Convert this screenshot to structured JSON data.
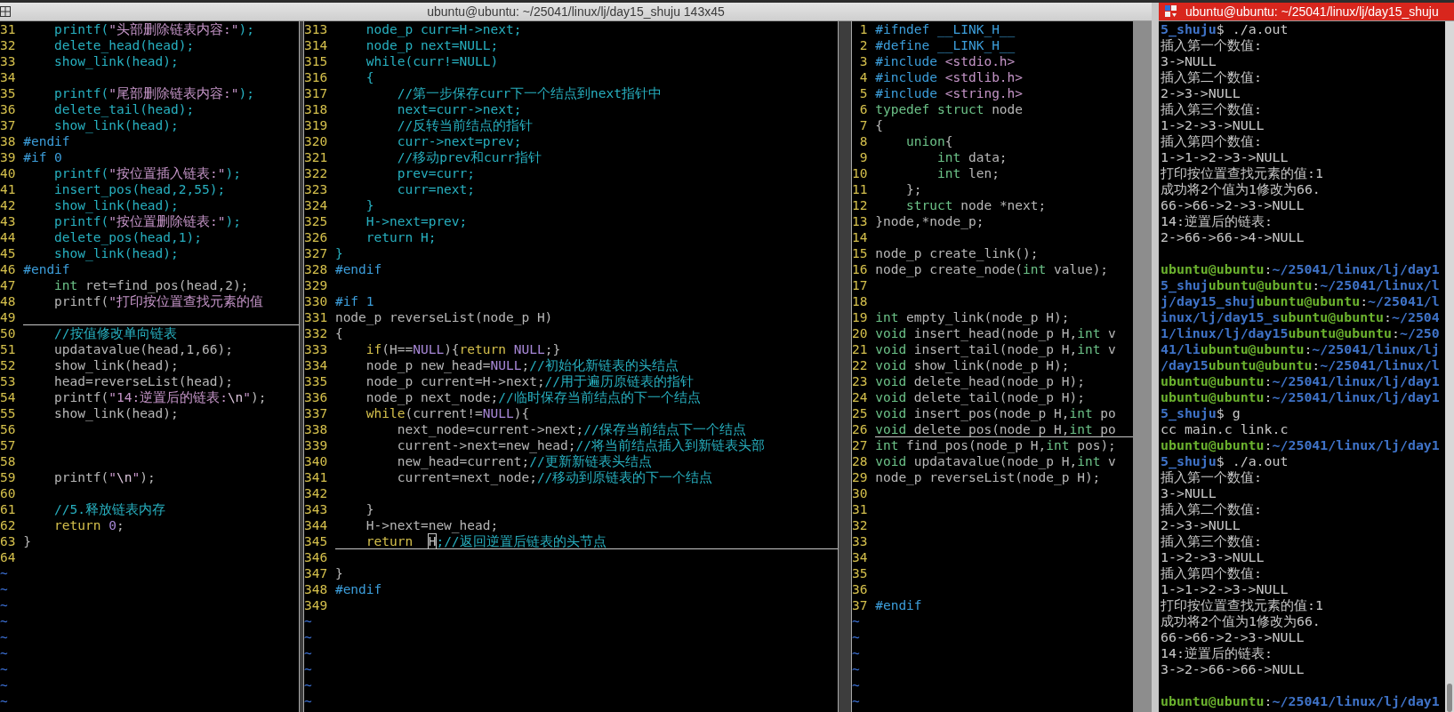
{
  "editor_window": {
    "title": "ubuntu@ubuntu: ~/25041/linux/lj/day15_shuju 143x45",
    "panes": [
      {
        "lines": [
          {
            "number": "31",
            "current": false,
            "tokens": [
              {
                "kind": "comment",
                "text": "    printf("
              },
              {
                "kind": "string",
                "text": "\"头部删除链表内容:\""
              },
              {
                "kind": "comment",
                "text": ");"
              }
            ]
          },
          {
            "number": "32",
            "current": false,
            "tokens": [
              {
                "kind": "comment",
                "text": "    delete_head(head);"
              }
            ]
          },
          {
            "number": "33",
            "current": false,
            "tokens": [
              {
                "kind": "comment",
                "text": "    show_link(head);"
              }
            ]
          },
          {
            "number": "34",
            "current": false
          },
          {
            "number": "35",
            "current": false,
            "tokens": [
              {
                "kind": "comment",
                "text": "    printf("
              },
              {
                "kind": "string",
                "text": "\"尾部删除链表内容:\""
              },
              {
                "kind": "comment",
                "text": ");"
              }
            ]
          },
          {
            "number": "36",
            "current": false,
            "tokens": [
              {
                "kind": "comment",
                "text": "    delete_tail(head);"
              }
            ]
          },
          {
            "number": "37",
            "current": false,
            "tokens": [
              {
                "kind": "comment",
                "text": "    show_link(head);"
              }
            ]
          },
          {
            "number": "38",
            "current": false,
            "tokens": [
              {
                "kind": "preproc",
                "text": "#endif"
              }
            ]
          },
          {
            "number": "39",
            "current": false,
            "tokens": [
              {
                "kind": "preproc",
                "text": "#if 0"
              }
            ]
          },
          {
            "number": "40",
            "current": false,
            "tokens": [
              {
                "kind": "comment",
                "text": "    printf("
              },
              {
                "kind": "string",
                "text": "\"按位置插入链表:\""
              },
              {
                "kind": "comment",
                "text": ");"
              }
            ]
          },
          {
            "number": "41",
            "current": false,
            "tokens": [
              {
                "kind": "comment",
                "text": "    insert_pos(head,2,55);"
              }
            ]
          },
          {
            "number": "42",
            "current": false,
            "tokens": [
              {
                "kind": "comment",
                "text": "    show_link(head);"
              }
            ]
          },
          {
            "number": "43",
            "current": false,
            "tokens": [
              {
                "kind": "comment",
                "text": "    printf("
              },
              {
                "kind": "string",
                "text": "\"按位置删除链表:\""
              },
              {
                "kind": "comment",
                "text": ");"
              }
            ]
          },
          {
            "number": "44",
            "current": false,
            "tokens": [
              {
                "kind": "comment",
                "text": "    delete_pos(head,1);"
              }
            ]
          },
          {
            "number": "45",
            "current": false,
            "tokens": [
              {
                "kind": "comment",
                "text": "    show_link(head);"
              }
            ]
          },
          {
            "number": "46",
            "current": false,
            "tokens": [
              {
                "kind": "preproc",
                "text": "#endif"
              }
            ]
          },
          {
            "number": "47",
            "current": false,
            "tokens": [
              {
                "kind": "type",
                "text": "    int"
              },
              {
                "kind": "plain",
                "text": " ret=find_pos(head,2);"
              }
            ]
          },
          {
            "number": "48",
            "current": false,
            "tokens": [
              {
                "kind": "plain",
                "text": "    printf("
              },
              {
                "kind": "string",
                "text": "\"打印按位置查找元素的值"
              }
            ]
          },
          {
            "number": "49",
            "current": true
          },
          {
            "number": "50",
            "current": false,
            "tokens": [
              {
                "kind": "comment",
                "text": "    //按值修改单向链表"
              }
            ]
          },
          {
            "number": "51",
            "current": false,
            "tokens": [
              {
                "kind": "plain",
                "text": "    updatavalue(head,1,66);"
              }
            ]
          },
          {
            "number": "52",
            "current": false,
            "tokens": [
              {
                "kind": "plain",
                "text": "    show_link(head);"
              }
            ]
          },
          {
            "number": "53",
            "current": false,
            "tokens": [
              {
                "kind": "plain",
                "text": "    head=reverseList(head);"
              }
            ]
          },
          {
            "number": "54",
            "current": false,
            "tokens": [
              {
                "kind": "plain",
                "text": "    printf("
              },
              {
                "kind": "string",
                "text": "\"14:逆置后的链表:"
              },
              {
                "kind": "special",
                "text": "\\n"
              },
              {
                "kind": "string",
                "text": "\""
              },
              {
                "kind": "plain",
                "text": ");"
              }
            ]
          },
          {
            "number": "55",
            "current": false,
            "tokens": [
              {
                "kind": "plain",
                "text": "    show_link(head);"
              }
            ]
          },
          {
            "number": "56",
            "current": false
          },
          {
            "number": "57",
            "current": false
          },
          {
            "number": "58",
            "current": false
          },
          {
            "number": "59",
            "current": false,
            "tokens": [
              {
                "kind": "plain",
                "text": "    printf("
              },
              {
                "kind": "string",
                "text": "\""
              },
              {
                "kind": "special",
                "text": "\\n"
              },
              {
                "kind": "string",
                "text": "\""
              },
              {
                "kind": "plain",
                "text": ");"
              }
            ]
          },
          {
            "number": "60",
            "current": false
          },
          {
            "number": "61",
            "current": false,
            "tokens": [
              {
                "kind": "comment",
                "text": "    //5.释放链表内存"
              }
            ]
          },
          {
            "number": "62",
            "current": false,
            "tokens": [
              {
                "kind": "keyword",
                "text": "    return"
              },
              {
                "kind": "constant",
                "text": " 0"
              },
              {
                "kind": "plain",
                "text": ";"
              }
            ]
          },
          {
            "number": "63",
            "current": false,
            "tokens": [
              {
                "kind": "plain",
                "text": "}"
              }
            ]
          },
          {
            "number": "64",
            "current": false
          }
        ],
        "filler": [
          "~",
          "~",
          "~",
          "~",
          "~",
          "~",
          "~",
          "~",
          "~"
        ]
      },
      {
        "lines": [
          {
            "number": "313",
            "current": false,
            "tokens": [
              {
                "kind": "comment",
                "text": "    node_p curr=H->next;"
              }
            ]
          },
          {
            "number": "314",
            "current": false,
            "tokens": [
              {
                "kind": "comment",
                "text": "    node_p next=NULL;"
              }
            ]
          },
          {
            "number": "315",
            "current": false,
            "tokens": [
              {
                "kind": "comment",
                "text": "    while(curr!=NULL)"
              }
            ]
          },
          {
            "number": "316",
            "current": false,
            "tokens": [
              {
                "kind": "comment",
                "text": "    {"
              }
            ]
          },
          {
            "number": "317",
            "current": false,
            "tokens": [
              {
                "kind": "comment",
                "text": "        //第一步保存curr下一个结点到next指针中"
              }
            ]
          },
          {
            "number": "318",
            "current": false,
            "tokens": [
              {
                "kind": "comment",
                "text": "        next=curr->next;"
              }
            ]
          },
          {
            "number": "319",
            "current": false,
            "tokens": [
              {
                "kind": "comment",
                "text": "        //反转当前结点的指针"
              }
            ]
          },
          {
            "number": "320",
            "current": false,
            "tokens": [
              {
                "kind": "comment",
                "text": "        curr->next=prev;"
              }
            ]
          },
          {
            "number": "321",
            "current": false,
            "tokens": [
              {
                "kind": "comment",
                "text": "        //移动prev和curr指针"
              }
            ]
          },
          {
            "number": "322",
            "current": false,
            "tokens": [
              {
                "kind": "comment",
                "text": "        prev=curr;"
              }
            ]
          },
          {
            "number": "323",
            "current": false,
            "tokens": [
              {
                "kind": "comment",
                "text": "        curr=next;"
              }
            ]
          },
          {
            "number": "324",
            "current": false,
            "tokens": [
              {
                "kind": "comment",
                "text": "    }"
              }
            ]
          },
          {
            "number": "325",
            "current": false,
            "tokens": [
              {
                "kind": "comment",
                "text": "    H->next=prev;"
              }
            ]
          },
          {
            "number": "326",
            "current": false,
            "tokens": [
              {
                "kind": "comment",
                "text": "    return H;"
              }
            ]
          },
          {
            "number": "327",
            "current": false,
            "tokens": [
              {
                "kind": "comment",
                "text": "}"
              }
            ]
          },
          {
            "number": "328",
            "current": false,
            "tokens": [
              {
                "kind": "preproc",
                "text": "#endif"
              }
            ]
          },
          {
            "number": "329",
            "current": false
          },
          {
            "number": "330",
            "current": false,
            "tokens": [
              {
                "kind": "preproc",
                "text": "#if 1"
              }
            ]
          },
          {
            "number": "331",
            "current": false,
            "tokens": [
              {
                "kind": "plain",
                "text": "node_p reverseList(node_p H)"
              }
            ]
          },
          {
            "number": "332",
            "current": false,
            "tokens": [
              {
                "kind": "plain",
                "text": "{"
              }
            ]
          },
          {
            "number": "333",
            "current": false,
            "tokens": [
              {
                "kind": "keyword",
                "text": "    if"
              },
              {
                "kind": "plain",
                "text": "(H=="
              },
              {
                "kind": "constant",
                "text": "NULL"
              },
              {
                "kind": "plain",
                "text": "){"
              },
              {
                "kind": "keyword",
                "text": "return"
              },
              {
                "kind": "constant",
                "text": " NULL"
              },
              {
                "kind": "plain",
                "text": ";}"
              }
            ]
          },
          {
            "number": "334",
            "current": false,
            "tokens": [
              {
                "kind": "plain",
                "text": "    node_p new_head="
              },
              {
                "kind": "constant",
                "text": "NULL"
              },
              {
                "kind": "plain",
                "text": ";"
              },
              {
                "kind": "comment",
                "text": "//初始化新链表的头结点"
              }
            ]
          },
          {
            "number": "335",
            "current": false,
            "tokens": [
              {
                "kind": "plain",
                "text": "    node_p current=H->next;"
              },
              {
                "kind": "comment",
                "text": "//用于遍历原链表的指针"
              }
            ]
          },
          {
            "number": "336",
            "current": false,
            "tokens": [
              {
                "kind": "plain",
                "text": "    node_p next_node;"
              },
              {
                "kind": "comment",
                "text": "//临时保存当前结点的下一个结点"
              }
            ]
          },
          {
            "number": "337",
            "current": false,
            "tokens": [
              {
                "kind": "keyword",
                "text": "    while"
              },
              {
                "kind": "plain",
                "text": "(current!="
              },
              {
                "kind": "constant",
                "text": "NULL"
              },
              {
                "kind": "plain",
                "text": "){"
              }
            ]
          },
          {
            "number": "338",
            "current": false,
            "tokens": [
              {
                "kind": "plain",
                "text": "        next_node=current->next;"
              },
              {
                "kind": "comment",
                "text": "//保存当前结点下一个结点"
              }
            ]
          },
          {
            "number": "339",
            "current": false,
            "tokens": [
              {
                "kind": "plain",
                "text": "        current->next=new_head;"
              },
              {
                "kind": "comment",
                "text": "//将当前结点插入到新链表头部"
              }
            ]
          },
          {
            "number": "340",
            "current": false,
            "tokens": [
              {
                "kind": "plain",
                "text": "        new_head=current;"
              },
              {
                "kind": "comment",
                "text": "//更新新链表头结点"
              }
            ]
          },
          {
            "number": "341",
            "current": false,
            "tokens": [
              {
                "kind": "plain",
                "text": "        current=next_node;"
              },
              {
                "kind": "comment",
                "text": "//移动到原链表的下一个结点"
              }
            ]
          },
          {
            "number": "342",
            "current": false
          },
          {
            "number": "343",
            "current": false,
            "tokens": [
              {
                "kind": "plain",
                "text": "    }"
              }
            ]
          },
          {
            "number": "344",
            "current": false,
            "tokens": [
              {
                "kind": "plain",
                "text": "    H->next=new_head;"
              }
            ]
          },
          {
            "number": "345",
            "current": true,
            "tokens": [
              {
                "kind": "keyword",
                "text": "    return  "
              },
              {
                "kind": "cursor",
                "text": "H"
              },
              {
                "kind": "comment",
                "text": ";//返回逆置后链表的头节点"
              }
            ]
          },
          {
            "number": "346",
            "current": false
          },
          {
            "number": "347",
            "current": false,
            "tokens": [
              {
                "kind": "plain",
                "text": "}"
              }
            ]
          },
          {
            "number": "348",
            "current": false,
            "tokens": [
              {
                "kind": "preproc",
                "text": "#endif"
              }
            ]
          },
          {
            "number": "349",
            "current": false
          }
        ],
        "filler": [
          "~",
          "~",
          "~",
          "~",
          "~",
          "~"
        ]
      },
      {
        "lines": [
          {
            "number": "1",
            "current": false,
            "tokens": [
              {
                "kind": "preproc",
                "text": "#ifndef __LINK_H__"
              }
            ]
          },
          {
            "number": "2",
            "current": false,
            "tokens": [
              {
                "kind": "preproc",
                "text": "#define __LINK_H__"
              }
            ]
          },
          {
            "number": "3",
            "current": false,
            "tokens": [
              {
                "kind": "preproc",
                "text": "#include "
              },
              {
                "kind": "string",
                "text": "<stdio.h>"
              }
            ]
          },
          {
            "number": "4",
            "current": false,
            "tokens": [
              {
                "kind": "preproc",
                "text": "#include "
              },
              {
                "kind": "string",
                "text": "<stdlib.h>"
              }
            ]
          },
          {
            "number": "5",
            "current": false,
            "tokens": [
              {
                "kind": "preproc",
                "text": "#include "
              },
              {
                "kind": "string",
                "text": "<string.h>"
              }
            ]
          },
          {
            "number": "6",
            "current": false,
            "tokens": [
              {
                "kind": "type",
                "text": "typedef struct"
              },
              {
                "kind": "plain",
                "text": " node"
              }
            ]
          },
          {
            "number": "7",
            "current": false,
            "tokens": [
              {
                "kind": "plain",
                "text": "{"
              }
            ]
          },
          {
            "number": "8",
            "current": false,
            "tokens": [
              {
                "kind": "type",
                "text": "    union"
              },
              {
                "kind": "plain",
                "text": "{"
              }
            ]
          },
          {
            "number": "9",
            "current": false,
            "tokens": [
              {
                "kind": "type",
                "text": "        int"
              },
              {
                "kind": "plain",
                "text": " data;"
              }
            ]
          },
          {
            "number": "10",
            "current": false,
            "tokens": [
              {
                "kind": "type",
                "text": "        int"
              },
              {
                "kind": "plain",
                "text": " len;"
              }
            ]
          },
          {
            "number": "11",
            "current": false,
            "tokens": [
              {
                "kind": "plain",
                "text": "    };"
              }
            ]
          },
          {
            "number": "12",
            "current": false,
            "tokens": [
              {
                "kind": "type",
                "text": "    struct"
              },
              {
                "kind": "plain",
                "text": " node *next;"
              }
            ]
          },
          {
            "number": "13",
            "current": false,
            "tokens": [
              {
                "kind": "plain",
                "text": "}node,*node_p;"
              }
            ]
          },
          {
            "number": "14",
            "current": false
          },
          {
            "number": "15",
            "current": false,
            "tokens": [
              {
                "kind": "plain",
                "text": "node_p create_link();"
              }
            ]
          },
          {
            "number": "16",
            "current": false,
            "tokens": [
              {
                "kind": "plain",
                "text": "node_p create_node("
              },
              {
                "kind": "type",
                "text": "int"
              },
              {
                "kind": "plain",
                "text": " value);"
              }
            ]
          },
          {
            "number": "17",
            "current": false
          },
          {
            "number": "18",
            "current": false
          },
          {
            "number": "19",
            "current": false,
            "tokens": [
              {
                "kind": "type",
                "text": "int"
              },
              {
                "kind": "plain",
                "text": " empty_link(node_p H);"
              }
            ]
          },
          {
            "number": "20",
            "current": false,
            "tokens": [
              {
                "kind": "type",
                "text": "void"
              },
              {
                "kind": "plain",
                "text": " insert_head(node_p H,"
              },
              {
                "kind": "type",
                "text": "int"
              },
              {
                "kind": "plain",
                "text": " v"
              }
            ]
          },
          {
            "number": "21",
            "current": false,
            "tokens": [
              {
                "kind": "type",
                "text": "void"
              },
              {
                "kind": "plain",
                "text": " insert_tail(node_p H,"
              },
              {
                "kind": "type",
                "text": "int"
              },
              {
                "kind": "plain",
                "text": " v"
              }
            ]
          },
          {
            "number": "22",
            "current": false,
            "tokens": [
              {
                "kind": "type",
                "text": "void"
              },
              {
                "kind": "plain",
                "text": " show_link(node_p H);"
              }
            ]
          },
          {
            "number": "23",
            "current": false,
            "tokens": [
              {
                "kind": "type",
                "text": "void"
              },
              {
                "kind": "plain",
                "text": " delete_head(node_p H);"
              }
            ]
          },
          {
            "number": "24",
            "current": false,
            "tokens": [
              {
                "kind": "type",
                "text": "void"
              },
              {
                "kind": "plain",
                "text": " delete_tail(node_p H);"
              }
            ]
          },
          {
            "number": "25",
            "current": false,
            "tokens": [
              {
                "kind": "type",
                "text": "void"
              },
              {
                "kind": "plain",
                "text": " insert_pos(node_p H,"
              },
              {
                "kind": "type",
                "text": "int"
              },
              {
                "kind": "plain",
                "text": " po"
              }
            ]
          },
          {
            "number": "26",
            "current": true,
            "tokens": [
              {
                "kind": "type",
                "text": "void"
              },
              {
                "kind": "plain",
                "text": " delete_pos(node_p H,"
              },
              {
                "kind": "type",
                "text": "int"
              },
              {
                "kind": "plain",
                "text": " po"
              }
            ]
          },
          {
            "number": "27",
            "current": false,
            "tokens": [
              {
                "kind": "type",
                "text": "int"
              },
              {
                "kind": "plain",
                "text": " find_pos(node_p H,"
              },
              {
                "kind": "type",
                "text": "int"
              },
              {
                "kind": "plain",
                "text": " pos);"
              }
            ]
          },
          {
            "number": "28",
            "current": false,
            "tokens": [
              {
                "kind": "type",
                "text": "void"
              },
              {
                "kind": "plain",
                "text": " updatavalue(node_p H,"
              },
              {
                "kind": "type",
                "text": "int"
              },
              {
                "kind": "plain",
                "text": " v"
              }
            ]
          },
          {
            "number": "29",
            "current": false,
            "tokens": [
              {
                "kind": "plain",
                "text": "node_p reverseList(node_p H);"
              }
            ]
          },
          {
            "number": "30",
            "current": false
          },
          {
            "number": "31",
            "current": false
          },
          {
            "number": "32",
            "current": false
          },
          {
            "number": "33",
            "current": false
          },
          {
            "number": "34",
            "current": false
          },
          {
            "number": "35",
            "current": false
          },
          {
            "number": "36",
            "current": false
          },
          {
            "number": "37",
            "current": false,
            "tokens": [
              {
                "kind": "preproc",
                "text": "#endif"
              }
            ]
          }
        ],
        "filler": [
          "~",
          "~",
          "~",
          "~",
          "~",
          "~"
        ]
      }
    ]
  },
  "terminal_window": {
    "title": "ubuntu@ubuntu: ~/25041/linux/lj/day15_shuju",
    "lines": [
      {
        "kind": "text",
        "segments": [
          {
            "kind": "path",
            "text": "5_shuju"
          },
          {
            "kind": "plain",
            "text": "$ ./a.out"
          }
        ]
      },
      {
        "kind": "text",
        "segments": [
          {
            "kind": "plain",
            "text": "插入第一个数值:"
          }
        ]
      },
      {
        "kind": "text",
        "segments": [
          {
            "kind": "plain",
            "text": "3->NULL"
          }
        ]
      },
      {
        "kind": "text",
        "segments": [
          {
            "kind": "plain",
            "text": "插入第二个数值:"
          }
        ]
      },
      {
        "kind": "text",
        "segments": [
          {
            "kind": "plain",
            "text": "2->3->NULL"
          }
        ]
      },
      {
        "kind": "text",
        "segments": [
          {
            "kind": "plain",
            "text": "插入第三个数值:"
          }
        ]
      },
      {
        "kind": "text",
        "segments": [
          {
            "kind": "plain",
            "text": "1->2->3->NULL"
          }
        ]
      },
      {
        "kind": "text",
        "segments": [
          {
            "kind": "plain",
            "text": "插入第四个数值:"
          }
        ]
      },
      {
        "kind": "text",
        "segments": [
          {
            "kind": "plain",
            "text": "1->1->2->3->NULL"
          }
        ]
      },
      {
        "kind": "text",
        "segments": [
          {
            "kind": "plain",
            "text": "打印按位置查找元素的值:1"
          }
        ]
      },
      {
        "kind": "text",
        "segments": [
          {
            "kind": "plain",
            "text": "成功将2个值为1修改为66."
          }
        ]
      },
      {
        "kind": "text",
        "segments": [
          {
            "kind": "plain",
            "text": "66->66->2->3->NULL"
          }
        ]
      },
      {
        "kind": "text",
        "segments": [
          {
            "kind": "plain",
            "text": "14:逆置后的链表:"
          }
        ]
      },
      {
        "kind": "text",
        "segments": [
          {
            "kind": "plain",
            "text": "2->66->66->4->NULL"
          }
        ]
      },
      {
        "kind": "blank"
      },
      {
        "kind": "text",
        "segments": [
          {
            "kind": "user",
            "text": "ubuntu@ubuntu"
          },
          {
            "kind": "plain",
            "text": ":"
          },
          {
            "kind": "path",
            "text": "~/25041/linux/lj/day1"
          }
        ]
      },
      {
        "kind": "text",
        "segments": [
          {
            "kind": "path",
            "text": "5_shuj"
          },
          {
            "kind": "user",
            "text": "ubuntu@ubuntu"
          },
          {
            "kind": "plain",
            "text": ":"
          },
          {
            "kind": "path",
            "text": "~/25041/linux/l"
          }
        ]
      },
      {
        "kind": "text",
        "segments": [
          {
            "kind": "path",
            "text": "j/day15_shuj"
          },
          {
            "kind": "user",
            "text": "ubuntu@ubuntu"
          },
          {
            "kind": "plain",
            "text": ":"
          },
          {
            "kind": "path",
            "text": "~/25041/l"
          }
        ]
      },
      {
        "kind": "text",
        "segments": [
          {
            "kind": "path",
            "text": "inux/lj/day15_s"
          },
          {
            "kind": "user",
            "text": "ubuntu@ubuntu"
          },
          {
            "kind": "plain",
            "text": ":"
          },
          {
            "kind": "path",
            "text": "~/2504"
          }
        ]
      },
      {
        "kind": "text",
        "segments": [
          {
            "kind": "path",
            "text": "1/linux/lj/day15"
          },
          {
            "kind": "user",
            "text": "ubuntu@ubuntu"
          },
          {
            "kind": "plain",
            "text": ":"
          },
          {
            "kind": "path",
            "text": "~/250"
          }
        ]
      },
      {
        "kind": "text",
        "segments": [
          {
            "kind": "path",
            "text": "41/li"
          },
          {
            "kind": "user",
            "text": "ubuntu@ubuntu"
          },
          {
            "kind": "plain",
            "text": ":"
          },
          {
            "kind": "path",
            "text": "~/25041/linux/lj"
          }
        ]
      },
      {
        "kind": "text",
        "segments": [
          {
            "kind": "path",
            "text": "/day15"
          },
          {
            "kind": "user",
            "text": "ubuntu@ubuntu"
          },
          {
            "kind": "plain",
            "text": ":"
          },
          {
            "kind": "path",
            "text": "~/25041/linux/l"
          }
        ]
      },
      {
        "kind": "text",
        "segments": [
          {
            "kind": "user",
            "text": "ubuntu@ubuntu"
          },
          {
            "kind": "plain",
            "text": ":"
          },
          {
            "kind": "path",
            "text": "~/25041/linux/lj/day1"
          }
        ]
      },
      {
        "kind": "text",
        "segments": [
          {
            "kind": "user",
            "text": "ubuntu@ubuntu"
          },
          {
            "kind": "plain",
            "text": ":"
          },
          {
            "kind": "path",
            "text": "~/25041/linux/lj/day1"
          }
        ]
      },
      {
        "kind": "text",
        "segments": [
          {
            "kind": "path",
            "text": "5_shuju"
          },
          {
            "kind": "plain",
            "text": "$ g"
          }
        ]
      },
      {
        "kind": "text",
        "segments": [
          {
            "kind": "plain",
            "text": "cc main.c link.c"
          }
        ]
      },
      {
        "kind": "text",
        "segments": [
          {
            "kind": "user",
            "text": "ubuntu@ubuntu"
          },
          {
            "kind": "plain",
            "text": ":"
          },
          {
            "kind": "path",
            "text": "~/25041/linux/lj/day1"
          }
        ]
      },
      {
        "kind": "text",
        "segments": [
          {
            "kind": "path",
            "text": "5_shuju"
          },
          {
            "kind": "plain",
            "text": "$ ./a.out"
          }
        ]
      },
      {
        "kind": "text",
        "segments": [
          {
            "kind": "plain",
            "text": "插入第一个数值:"
          }
        ]
      },
      {
        "kind": "text",
        "segments": [
          {
            "kind": "plain",
            "text": "3->NULL"
          }
        ]
      },
      {
        "kind": "text",
        "segments": [
          {
            "kind": "plain",
            "text": "插入第二个数值:"
          }
        ]
      },
      {
        "kind": "text",
        "segments": [
          {
            "kind": "plain",
            "text": "2->3->NULL"
          }
        ]
      },
      {
        "kind": "text",
        "segments": [
          {
            "kind": "plain",
            "text": "插入第三个数值:"
          }
        ]
      },
      {
        "kind": "text",
        "segments": [
          {
            "kind": "plain",
            "text": "1->2->3->NULL"
          }
        ]
      },
      {
        "kind": "text",
        "segments": [
          {
            "kind": "plain",
            "text": "插入第四个数值:"
          }
        ]
      },
      {
        "kind": "text",
        "segments": [
          {
            "kind": "plain",
            "text": "1->1->2->3->NULL"
          }
        ]
      },
      {
        "kind": "text",
        "segments": [
          {
            "kind": "plain",
            "text": "打印按位置查找元素的值:1"
          }
        ]
      },
      {
        "kind": "text",
        "segments": [
          {
            "kind": "plain",
            "text": "成功将2个值为1修改为66."
          }
        ]
      },
      {
        "kind": "text",
        "segments": [
          {
            "kind": "plain",
            "text": "66->66->2->3->NULL"
          }
        ]
      },
      {
        "kind": "text",
        "segments": [
          {
            "kind": "plain",
            "text": "14:逆置后的链表:"
          }
        ]
      },
      {
        "kind": "text",
        "segments": [
          {
            "kind": "plain",
            "text": "3->2->66->66->NULL"
          }
        ]
      },
      {
        "kind": "blank"
      },
      {
        "kind": "text",
        "segments": [
          {
            "kind": "user",
            "text": "ubuntu@ubuntu"
          },
          {
            "kind": "plain",
            "text": ":"
          },
          {
            "kind": "path",
            "text": "~/25041/linux/lj/day1"
          }
        ]
      }
    ]
  }
}
